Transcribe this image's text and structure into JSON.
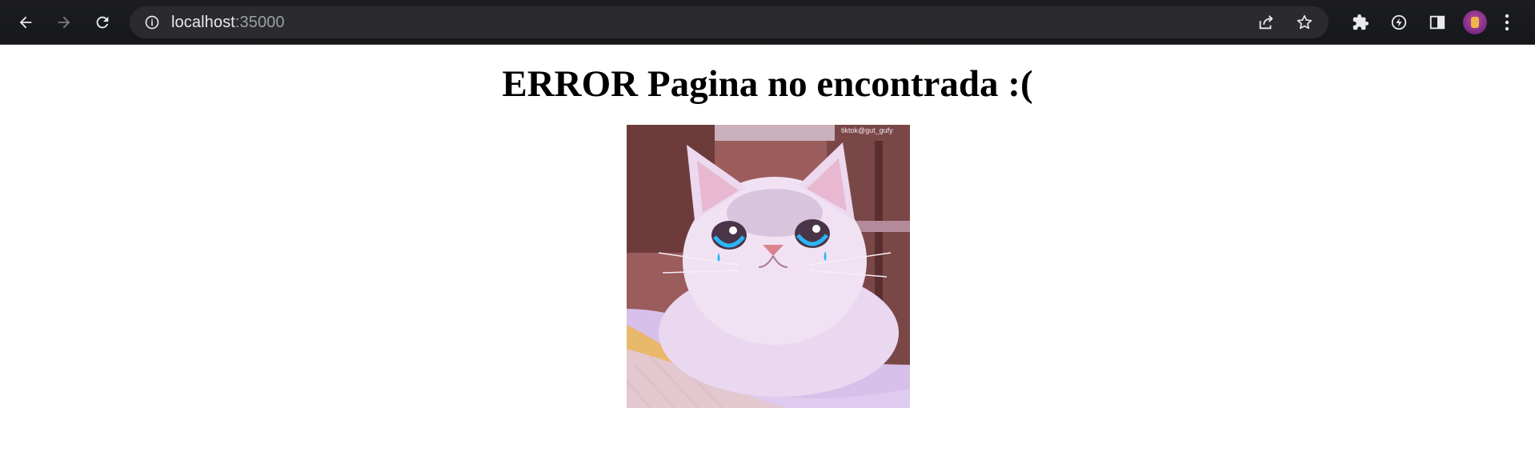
{
  "browser": {
    "url_host": "localhost",
    "url_port": ":35000",
    "icons": {
      "back": "back-arrow-icon",
      "forward": "forward-arrow-icon",
      "reload": "reload-icon",
      "site_info": "info-icon",
      "share": "share-icon",
      "bookmark": "star-icon",
      "extensions": "puzzle-icon",
      "performance": "lightning-icon",
      "side_panel": "side-panel-icon",
      "menu": "kebab-menu-icon"
    },
    "colors": {
      "toolbar_bg": "#1c1d20",
      "omnibox_bg": "#2b2b2d",
      "text": "#e8eaed",
      "muted": "#9aa0a6"
    }
  },
  "page": {
    "heading": "ERROR Pagina no encontrada :(",
    "image_alt": "crying-cat",
    "image_caption": "tiktok@gut_gufy"
  }
}
